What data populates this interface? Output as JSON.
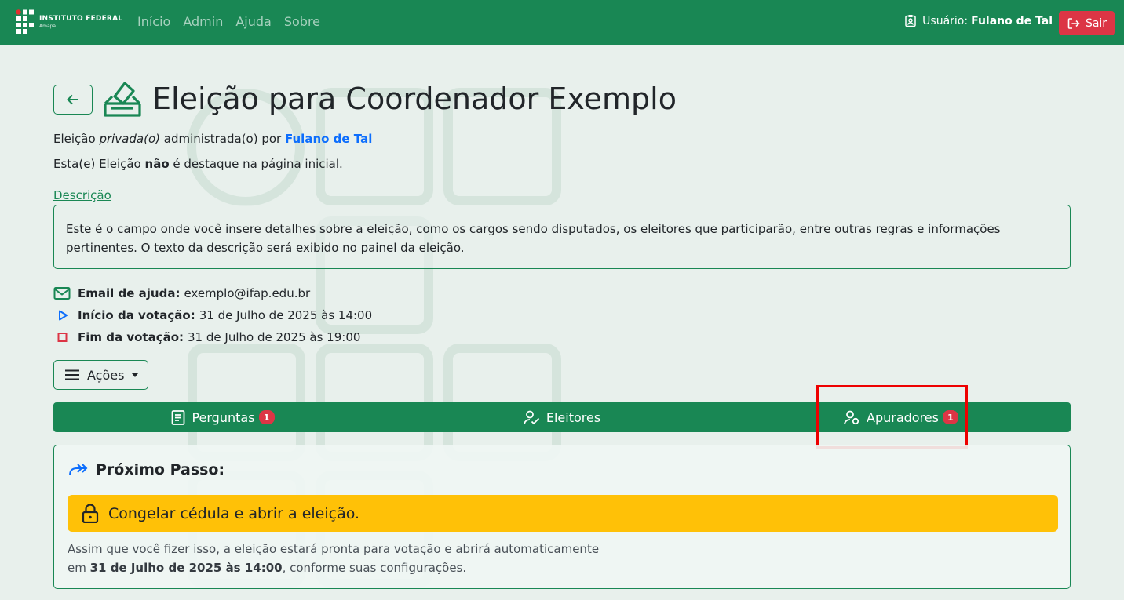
{
  "navbar": {
    "brand_title": "INSTITUTO FEDERAL",
    "brand_subtitle": "Amapá",
    "links": [
      "Início",
      "Admin",
      "Ajuda",
      "Sobre"
    ],
    "user_label": "Usuário:",
    "user_name": "Fulano de Tal",
    "logout_label": "Sair"
  },
  "page": {
    "title": "Eleição para Coordenador Exemplo",
    "visibility_prefix": "Eleição",
    "visibility": "privada(o)",
    "admin_text": "administrada(o) por",
    "admin_name": "Fulano de Tal",
    "featured_prefix": "Esta(e) Eleição",
    "featured_neg": "não",
    "featured_suffix": "é destaque na página inicial.",
    "description_label": "Descrição",
    "description": "Este é o campo onde você insere detalhes sobre a eleição, como os cargos sendo disputados, os eleitores que participarão, entre outras regras e informações pertinentes. O texto da descrição será exibido no painel da eleição."
  },
  "info": {
    "email_label": "Email de ajuda:",
    "email_value": "exemplo@ifap.edu.br",
    "start_label": "Início da votação:",
    "start_value": "31 de Julho de 2025 às 14:00",
    "end_label": "Fim da votação:",
    "end_value": "31 de Julho de 2025 às 19:00"
  },
  "actions_label": "Ações",
  "tabs": [
    {
      "label": "Perguntas",
      "badge": "1"
    },
    {
      "label": "Eleitores"
    },
    {
      "label": "Apuradores",
      "badge": "1"
    }
  ],
  "next_step": {
    "title": "Próximo Passo:",
    "action": "Congelar cédula e abrir a eleição.",
    "note_line1": "Assim que você fizer isso, a eleição estará pronta para votação e abrirá automaticamente",
    "note_prefix": "em",
    "note_date": "31 de Julho de 2025 às 14:00",
    "note_suffix": ", conforme suas configurações."
  },
  "colors": {
    "primary": "#198754",
    "danger": "#dc3545",
    "warning": "#ffc107",
    "link": "#0d6efd",
    "background": "#e8f0ec"
  }
}
